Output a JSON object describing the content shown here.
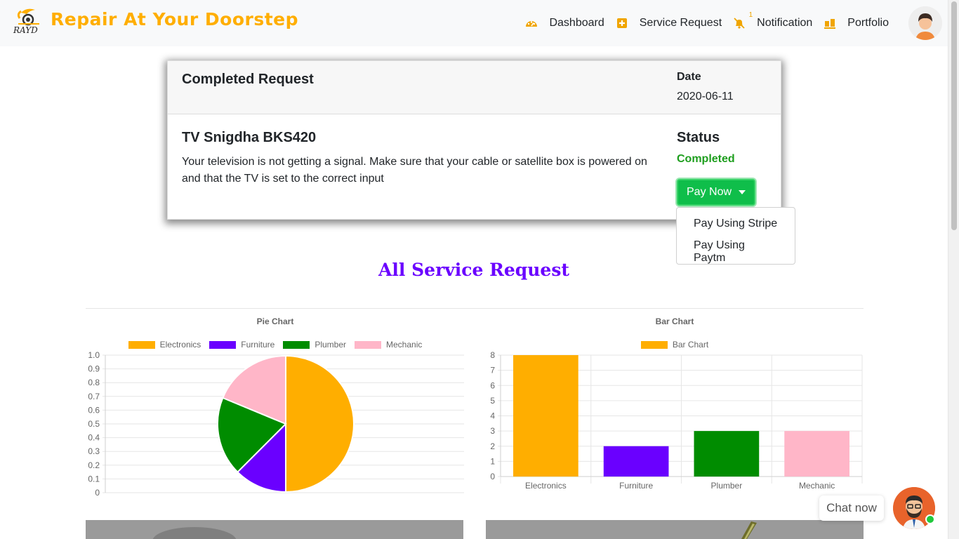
{
  "brand": {
    "name": "Repair At Your Doorstep",
    "logo_text": "RAYD"
  },
  "nav": {
    "items": [
      {
        "label": "Dashboard",
        "icon": "dashboard-icon"
      },
      {
        "label": "Service Request",
        "icon": "plus-square-icon"
      },
      {
        "label": "Notification",
        "icon": "bell-slash-icon",
        "badge": "1"
      },
      {
        "label": "Portfolio",
        "icon": "portfolio-icon"
      }
    ],
    "avatar": "user-avatar"
  },
  "request_card": {
    "header_title": "Completed Request",
    "date_label": "Date",
    "date_value": "2020-06-11",
    "request_title": "TV Snigdha BKS420",
    "description": "Your television is not getting a signal. Make sure that your cable or satellite box is powered on and that the TV is set to the correct input",
    "status_label": "Status",
    "status_value": "Completed",
    "pay_button": "Pay Now",
    "pay_options": [
      "Pay Using Stripe",
      "Pay Using Paytm"
    ]
  },
  "section": {
    "title": "All Service Request"
  },
  "colors": {
    "accent": "#ffae00",
    "electronics": "#ffae00",
    "furniture": "#6a00ff",
    "plumber": "#008c00",
    "mechanic": "#ffb6c8",
    "status_green": "#1e9e1e",
    "pay_button": "#0fbe4a"
  },
  "chat": {
    "label": "Chat now"
  },
  "chart_data": [
    {
      "type": "pie",
      "title": "Pie Chart",
      "categories": [
        "Electronics",
        "Furniture",
        "Plumber",
        "Mechanic"
      ],
      "values": [
        8,
        2,
        3,
        3
      ],
      "colors": [
        "#ffae00",
        "#6a00ff",
        "#008c00",
        "#ffb6c8"
      ],
      "ylim": [
        0,
        1.0
      ],
      "yticks": [
        "1.0",
        "0.9",
        "0.8",
        "0.7",
        "0.6",
        "0.5",
        "0.4",
        "0.3",
        "0.2",
        "0.1",
        "0"
      ],
      "grid": true,
      "legend": "top"
    },
    {
      "type": "bar",
      "title": "Bar Chart",
      "categories": [
        "Electronics",
        "Furniture",
        "Plumber",
        "Mechanic"
      ],
      "series": [
        {
          "name": "Bar Chart",
          "values": [
            8,
            2,
            3,
            3
          ]
        }
      ],
      "colors": [
        "#ffae00",
        "#6a00ff",
        "#008c00",
        "#ffb6c8"
      ],
      "legend_color": "#ffae00",
      "ylim": [
        0,
        8
      ],
      "yticks": [
        "8",
        "7",
        "6",
        "5",
        "4",
        "3",
        "2",
        "1",
        "0"
      ],
      "grid": true,
      "legend": "top"
    }
  ]
}
